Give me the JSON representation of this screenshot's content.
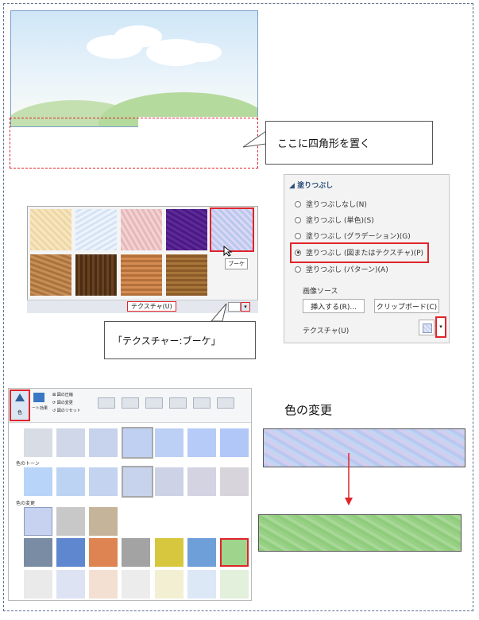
{
  "callouts": {
    "place_rect": "ここに四角形を置く",
    "texture_name": "「テクスチャー:ブーケ」"
  },
  "gallery": {
    "tooltip": "ブーケ",
    "footer_label": "テクスチャ(U)"
  },
  "fill_pane": {
    "title": "塗りつぶし",
    "options": [
      {
        "label": "塗りつぶしなし(N)",
        "selected": false
      },
      {
        "label": "塗りつぶし (単色)(S)",
        "selected": false
      },
      {
        "label": "塗りつぶし (グラデーション)(G)",
        "selected": false
      },
      {
        "label": "塗りつぶし (図またはテクスチャ)(P)",
        "selected": true
      },
      {
        "label": "塗りつぶし (パターン)(A)",
        "selected": false
      }
    ],
    "image_source_label": "画像ソース",
    "insert_button": "挿入する(R)...",
    "clipboard_button": "クリップボード(C)",
    "texture_label": "テクスチャ(U)"
  },
  "recolor_panel": {
    "color_button_label": "色",
    "art_effects_label": "ート効果",
    "compress_label": "図の圧縮",
    "change_label": "図の変更",
    "reset_label": "図のリセット",
    "section_tone": "色のトーン",
    "section_recolor": "色の変更"
  },
  "heading": "色の変更",
  "colors": {
    "accent_red": "#e0242a",
    "bouquet": "#c7d2f0",
    "green_texture": "#9fd48c",
    "hill": "#b9dca0"
  }
}
